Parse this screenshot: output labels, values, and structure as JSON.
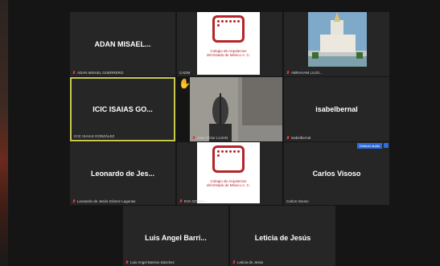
{
  "tiles": {
    "adan": {
      "name": "ADAN MISAEL...",
      "caption": "ADAN MISAEL GUERRERO"
    },
    "cadm_logo": {
      "caption": "CADM",
      "org_line1": "Colegio de Arquitectos",
      "org_line2": "del Estado de México A. C."
    },
    "abraham": {
      "caption": "ABRAHAM LUJO..."
    },
    "icic": {
      "name": "ICIC ISAIAS GO...",
      "caption": "ICIC ISAIAS GONZÁLEZ"
    },
    "juan_victor": {
      "caption": "Juan Víctor LUJAN"
    },
    "isabel": {
      "name": "isabelbernal",
      "caption": "isabelbernal"
    },
    "leonardo": {
      "name": "Leonardo de Jes...",
      "caption": "Leonardo de Jesús Gómez Lagunas"
    },
    "eva_logo": {
      "caption": "EVA GONZA...",
      "org_line1": "Colegio de Arquitectos",
      "org_line2": "del Estado de México A. C."
    },
    "carlos": {
      "name": "Carlos Visoso",
      "caption": "Carlos Visoso",
      "badge": "Detener audio"
    },
    "luis": {
      "name": "Luis Angel Barri...",
      "caption": "Luis Angel Barrios Sánchez"
    },
    "leticia": {
      "name": "Leticia de Jesús",
      "caption": "Leticia de Jesús"
    }
  },
  "colors": {
    "tile_bg": "#262626",
    "active_border": "#c9c84a",
    "logo_red": "#b5242a",
    "muted_mic": "#e03a3a",
    "badge_blue": "#2d6cdf"
  },
  "icons": [
    "muted-mic-icon",
    "raised-hand-icon"
  ]
}
